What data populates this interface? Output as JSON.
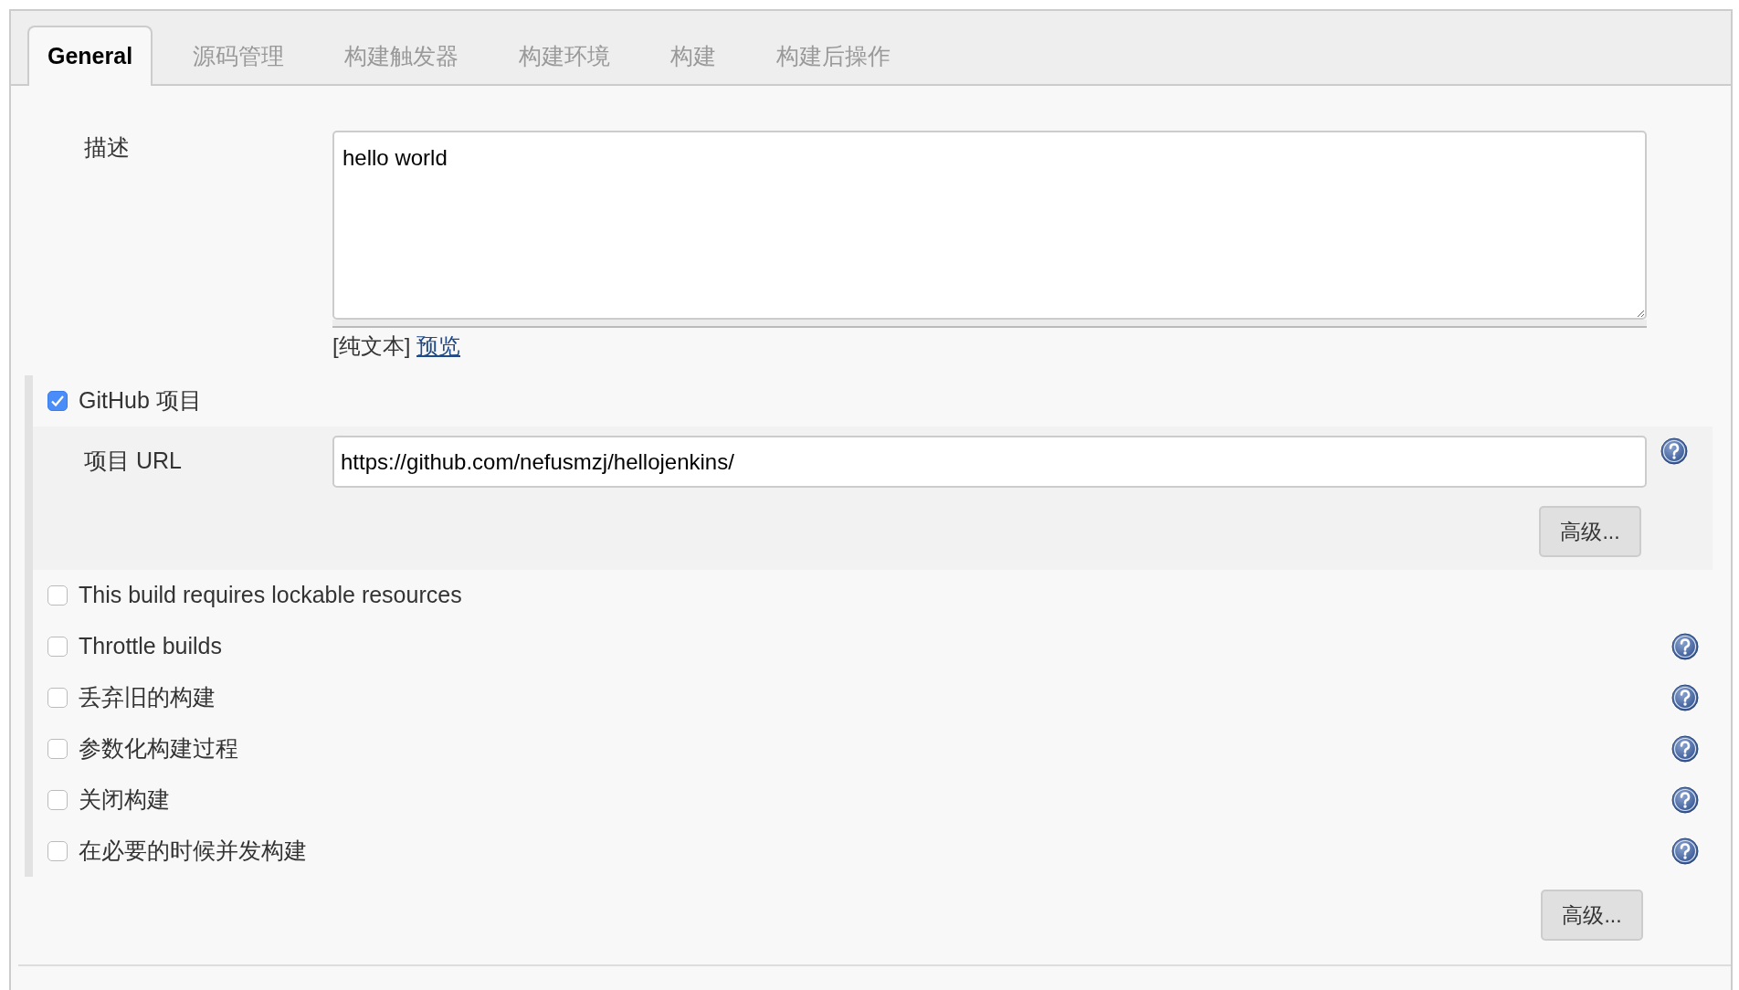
{
  "tabs": [
    {
      "label": "General",
      "selected": true
    },
    {
      "label": "源码管理",
      "selected": false
    },
    {
      "label": "构建触发器",
      "selected": false
    },
    {
      "label": "构建环境",
      "selected": false
    },
    {
      "label": "构建",
      "selected": false
    },
    {
      "label": "构建后操作",
      "selected": false
    }
  ],
  "description": {
    "label": "描述",
    "value": "hello world",
    "format_label": "[纯文本]",
    "preview_link": "预览"
  },
  "github_project": {
    "label": "GitHub 项目",
    "checked": true,
    "url_label": "项目 URL",
    "url_value": "https://github.com/nefusmzj/hellojenkins/",
    "has_help": true,
    "advanced_button": "高级..."
  },
  "options": [
    {
      "label": "This build requires lockable resources",
      "checked": false,
      "has_help": false
    },
    {
      "label": "Throttle builds",
      "checked": false,
      "has_help": true
    },
    {
      "label": "丢弃旧的构建",
      "checked": false,
      "has_help": true
    },
    {
      "label": "参数化构建过程",
      "checked": false,
      "has_help": true
    },
    {
      "label": "关闭构建",
      "checked": false,
      "has_help": true
    },
    {
      "label": "在必要的时候并发构建",
      "checked": false,
      "has_help": true
    }
  ],
  "advanced_button": "高级..."
}
